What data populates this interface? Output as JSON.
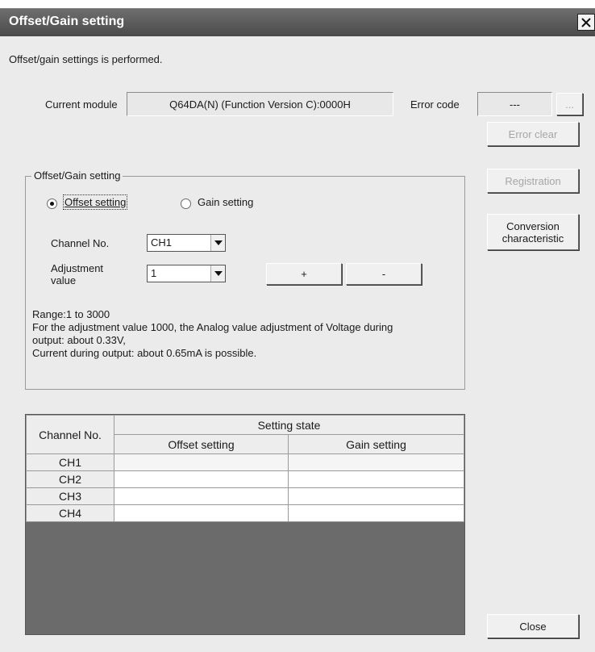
{
  "window": {
    "title": "Offset/Gain setting"
  },
  "description": "Offset/gain settings is performed.",
  "module": {
    "label": "Current module",
    "value": "Q64DA(N) (Function Version C):0000H"
  },
  "error": {
    "label": "Error code",
    "value": "---",
    "browse_label": "...",
    "clear_label": "Error clear"
  },
  "buttons": {
    "registration": "Registration",
    "conversion_line1": "Conversion",
    "conversion_line2": "characteristic",
    "close": "Close"
  },
  "group": {
    "title": "Offset/Gain setting",
    "offset_radio": "Offset setting",
    "gain_radio": "Gain setting",
    "selected": "offset",
    "channel_label": "Channel No.",
    "channel_value": "CH1",
    "adjust_label_line1": "Adjustment",
    "adjust_label_line2": "value",
    "adjust_value": "1",
    "plus_label": "+",
    "minus_label": "-",
    "range_lines": [
      "Range:1 to 3000",
      "For the adjustment value 1000, the Analog value adjustment of Voltage during",
      "output: about 0.33V,",
      "Current during output: about 0.65mA is possible."
    ]
  },
  "table": {
    "col_channel": "Channel No.",
    "col_state": "Setting state",
    "col_offset": "Offset setting",
    "col_gain": "Gain setting",
    "rows": [
      "CH1",
      "CH2",
      "CH3",
      "CH4"
    ]
  }
}
